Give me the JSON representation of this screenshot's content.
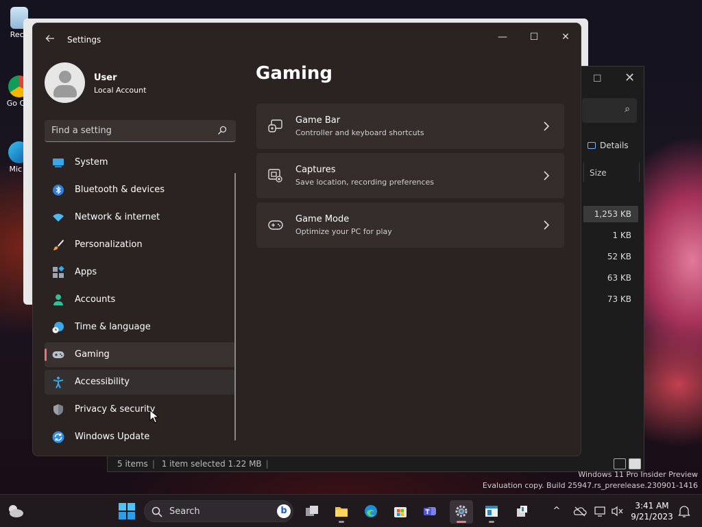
{
  "desktop": {
    "icons": [
      {
        "label": "Recy"
      },
      {
        "label": "Go Chi"
      },
      {
        "label": "Mic E"
      }
    ],
    "watermark": {
      "line1": "Windows 11 Pro Insider Preview",
      "line2": "Evaluation copy. Build 25947.rs_prerelease.230901-1416"
    }
  },
  "explorer": {
    "details_label": "Details",
    "size_header": "Size",
    "sizes": [
      "1,253 KB",
      "1 KB",
      "52 KB",
      "63 KB",
      "73 KB"
    ],
    "status": {
      "items": "5 items",
      "selected": "1 item selected  1.22 MB"
    }
  },
  "settings": {
    "window_title": "Settings",
    "user": {
      "name": "User",
      "account": "Local Account"
    },
    "search_placeholder": "Find a setting",
    "nav": [
      {
        "label": "System",
        "icon": "monitor-icon"
      },
      {
        "label": "Bluetooth & devices",
        "icon": "bluetooth-icon"
      },
      {
        "label": "Network & internet",
        "icon": "wifi-icon"
      },
      {
        "label": "Personalization",
        "icon": "brush-icon"
      },
      {
        "label": "Apps",
        "icon": "apps-icon"
      },
      {
        "label": "Accounts",
        "icon": "person-icon"
      },
      {
        "label": "Time & language",
        "icon": "globe-clock-icon"
      },
      {
        "label": "Gaming",
        "icon": "gamepad-icon",
        "selected": true
      },
      {
        "label": "Accessibility",
        "icon": "accessibility-icon"
      },
      {
        "label": "Privacy & security",
        "icon": "shield-icon"
      },
      {
        "label": "Windows Update",
        "icon": "update-icon"
      }
    ],
    "page_title": "Gaming",
    "cards": [
      {
        "title": "Game Bar",
        "subtitle": "Controller and keyboard shortcuts",
        "icon": "game-bar-icon"
      },
      {
        "title": "Captures",
        "subtitle": "Save location, recording preferences",
        "icon": "captures-icon"
      },
      {
        "title": "Game Mode",
        "subtitle": "Optimize your PC for play",
        "icon": "game-mode-icon"
      }
    ],
    "accent_color": "#f0707a"
  },
  "taskbar": {
    "search_label": "Search",
    "time": "3:41 AM",
    "date": "9/21/2023"
  }
}
